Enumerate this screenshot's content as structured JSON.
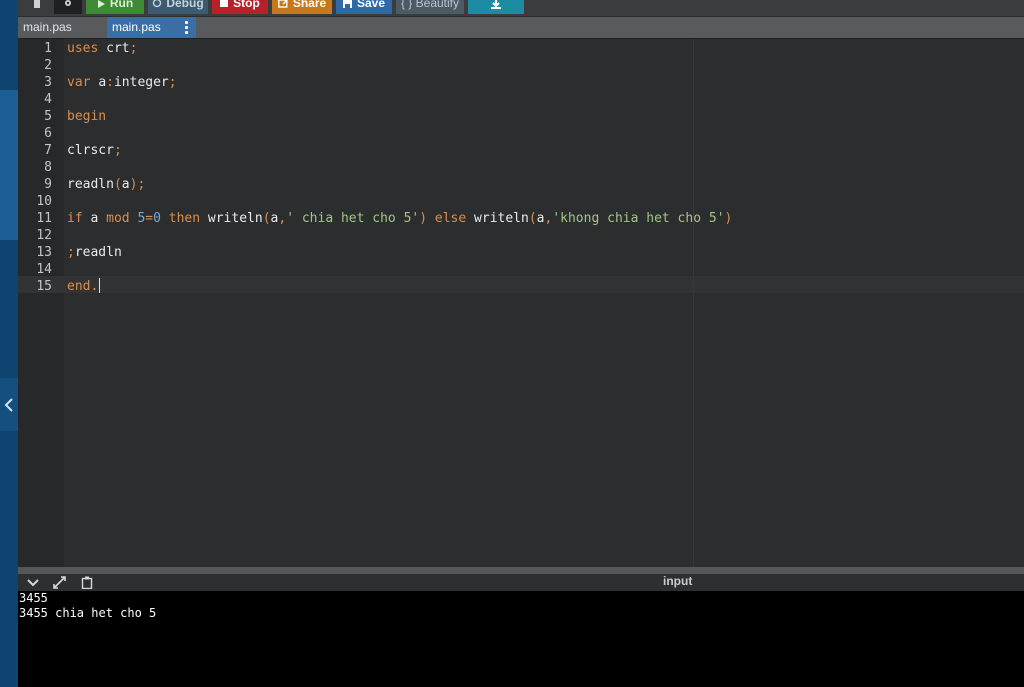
{
  "toolbar": {
    "buttons": [
      {
        "id": "run",
        "label": "Run",
        "color": "#3e8a37"
      },
      {
        "id": "debug",
        "label": "Debug",
        "color": "#3c5a70"
      },
      {
        "id": "stop",
        "label": "Stop",
        "color": "#b8202a"
      },
      {
        "id": "share",
        "label": "Share",
        "color": "#c8781a"
      },
      {
        "id": "save",
        "label": "Save",
        "color": "#2e6aa8"
      },
      {
        "id": "beautify",
        "label": "{ } Beautify",
        "color": "#4c5a66"
      },
      {
        "id": "download",
        "label": "",
        "color": "#1b8ca3"
      }
    ]
  },
  "tabs": [
    {
      "label": "main.pas",
      "active": false
    },
    {
      "label": "main.pas",
      "active": true
    }
  ],
  "editor": {
    "line_numbers": [
      "1",
      "2",
      "3",
      "4",
      "5",
      "6",
      "7",
      "8",
      "9",
      "10",
      "11",
      "12",
      "13",
      "14",
      "15"
    ],
    "lines": [
      {
        "n": 1,
        "text": "uses crt;"
      },
      {
        "n": 3,
        "text": "var a:integer;"
      },
      {
        "n": 5,
        "text": "begin"
      },
      {
        "n": 7,
        "text": "clrscr;"
      },
      {
        "n": 9,
        "text": "readln(a);"
      },
      {
        "n": 11,
        "text": "if a mod 5=0 then writeln(a,' chia het cho 5') else writeln(a,'khong chia het cho 5')"
      },
      {
        "n": 13,
        "text": ";readln"
      },
      {
        "n": 15,
        "text": "end."
      }
    ],
    "active_line": 15
  },
  "output": {
    "tab_label": "input",
    "console_lines": [
      "3455",
      "3455 chia het cho 5"
    ]
  },
  "colors": {
    "keyword": "#d98f4f",
    "string": "#a3c585",
    "number": "#78a9d8",
    "editor_bg": "#2b2d2e",
    "console_bg": "#000000"
  }
}
